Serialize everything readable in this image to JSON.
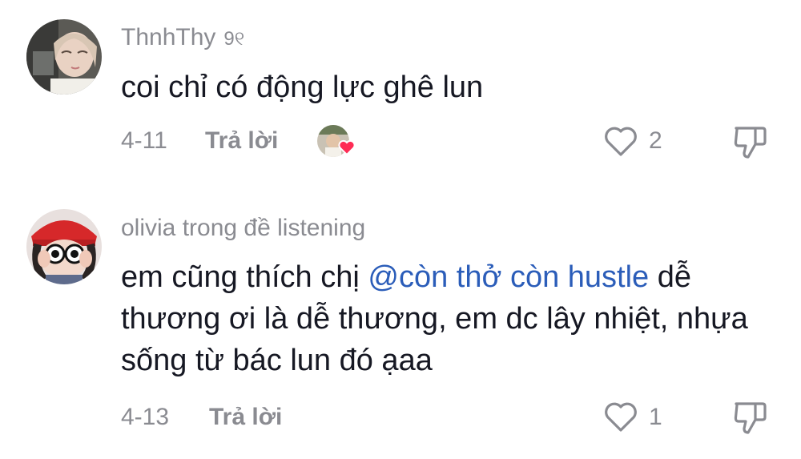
{
  "comments": [
    {
      "username": "ThnhThy",
      "badge": "9୧",
      "text": "coi chỉ có động lực ghê lun",
      "date": "4-11",
      "reply_label": "Trả lời",
      "like_count": "2",
      "avatar": "user-avatar-thnhthy",
      "liked_by_creator": true
    },
    {
      "username": "olivia trong đề listening",
      "text_before": "em cũng thích chị ",
      "mention": "@còn thở còn hustle",
      "text_after": " dễ thương ơi là dễ thương, em dc lây nhiệt, nhựa sống từ bác lun đó ạaa",
      "date": "4-13",
      "reply_label": "Trả lời",
      "like_count": "1",
      "avatar": "user-avatar-olivia"
    }
  ],
  "icons": {
    "like": "heart-outline-icon",
    "dislike": "thumbs-down-icon",
    "creator_heart": "heart-filled-icon"
  },
  "colors": {
    "mention": "#2b5db9",
    "secondary_text": "#8a8b91",
    "heart": "#fe2c55"
  }
}
